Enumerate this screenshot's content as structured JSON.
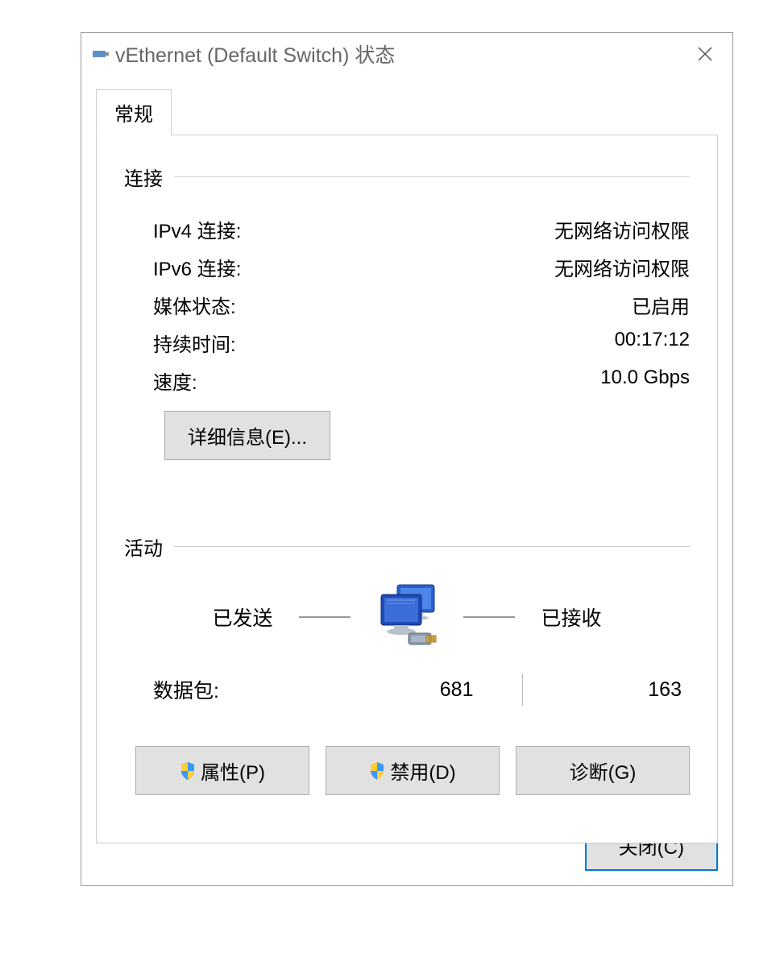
{
  "window": {
    "title": "vEthernet (Default Switch) 状态"
  },
  "tabs": {
    "general": "常规"
  },
  "connection": {
    "section_title": "连接",
    "ipv4_label": "IPv4 连接:",
    "ipv4_value": "无网络访问权限",
    "ipv6_label": "IPv6 连接:",
    "ipv6_value": "无网络访问权限",
    "media_label": "媒体状态:",
    "media_value": "已启用",
    "duration_label": "持续时间:",
    "duration_value": "00:17:12",
    "speed_label": "速度:",
    "speed_value": "10.0 Gbps",
    "details_button": "详细信息(E)..."
  },
  "activity": {
    "section_title": "活动",
    "sent_label": "已发送",
    "received_label": "已接收",
    "packets_label": "数据包:",
    "packets_sent": "681",
    "packets_received": "163"
  },
  "buttons": {
    "properties": "属性(P)",
    "disable": "禁用(D)",
    "diagnose": "诊断(G)",
    "close": "关闭(C)"
  }
}
